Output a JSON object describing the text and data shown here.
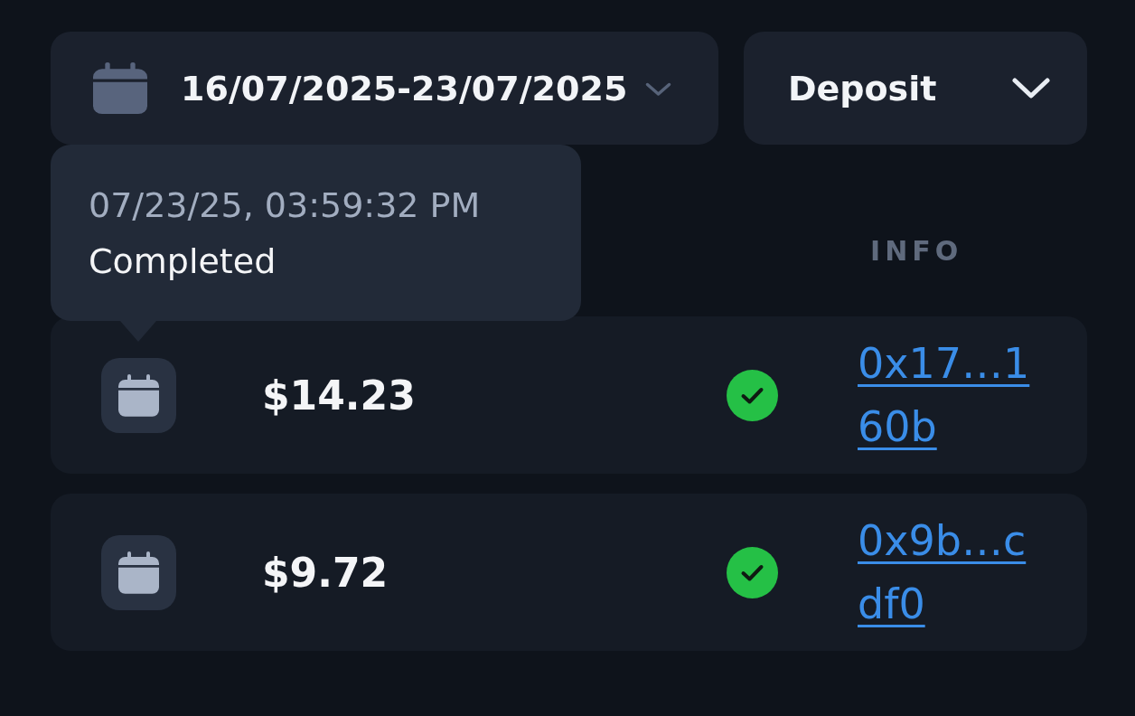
{
  "filters": {
    "date_range": {
      "value": "16/07/2025-23/07/2025"
    },
    "type_dropdown": {
      "value": "Deposit"
    }
  },
  "tooltip": {
    "datetime": "07/23/25, 03:59:32 PM",
    "status_text": "Completed"
  },
  "table": {
    "column_header": "INFO",
    "rows": [
      {
        "amount": "$14.23",
        "completed": true,
        "tx_link": "0x17…160b"
      },
      {
        "amount": "$9.72",
        "completed": true,
        "tx_link": "0x9b…cdf0"
      }
    ]
  }
}
